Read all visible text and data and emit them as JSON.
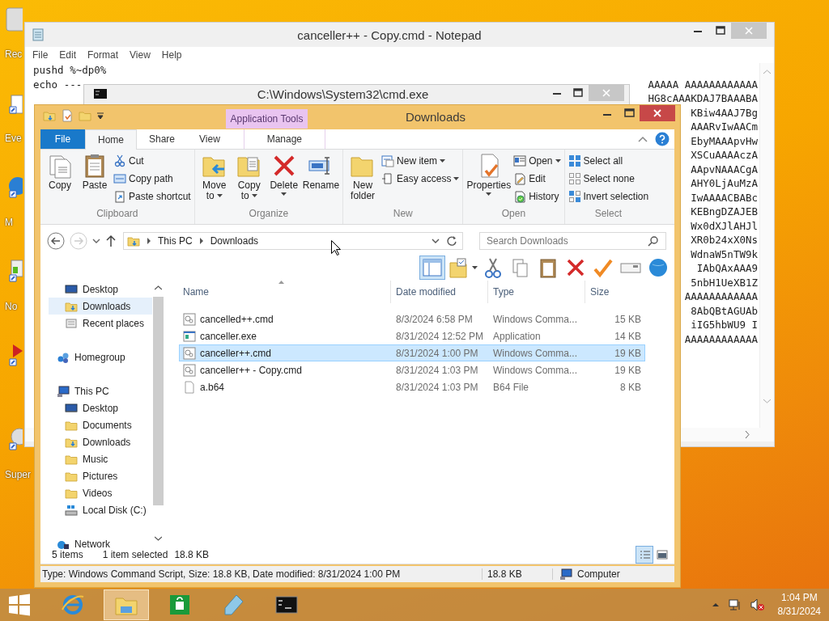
{
  "desktop": {
    "icons": [
      {
        "kind": "bin",
        "label": "Rec"
      },
      {
        "kind": "shortcut",
        "label": "Eve"
      },
      {
        "kind": "browser",
        "label": "M"
      },
      {
        "kind": "notes",
        "label": "No"
      },
      {
        "kind": "media"
      },
      {
        "kind": "disc",
        "label": "Super"
      }
    ]
  },
  "notepad": {
    "title": "canceller++ - Copy.cmd - Notepad",
    "menu": [
      "File",
      "Edit",
      "Format",
      "View",
      "Help"
    ],
    "lines": [
      {
        "left": "pushd %~dp0%"
      },
      {
        "left": "echo ---",
        "right": "AAAAA AAAAAAAAAAAA"
      },
      {
        "right": "HG8cAAAKDAJ7BAAABA"
      },
      {
        "right": "KBiw4AAJ7Bg"
      },
      {
        "right": "AAARvIwAACm"
      },
      {
        "right": "EbyMAAApvHw"
      },
      {
        "right": "XSCuAAAAczA"
      },
      {
        "right": "AApvNAAACgA"
      },
      {
        "right": "AHY0LjAuMzA"
      },
      {
        "right": "IwAAAACBABc"
      },
      {
        "right": "KEBngDZAJEB"
      },
      {
        "right": "Wx0dXJlAHJl"
      },
      {
        "right": "XR0b24xX0Ns"
      },
      {
        "right": "WdnaW5nTW9k"
      },
      {
        "right": "IAbQAxAAA9"
      },
      {
        "right": "5nbH1UeXB1Z"
      },
      {
        "right": "AAAAAAAAAAAA"
      },
      {
        "right": "8AbQBtAGUAb"
      },
      {
        "right": "iIG5hbWU9 I"
      },
      {
        "right": "AAAAAAAAAAAA"
      }
    ]
  },
  "cmd": {
    "title": "C:\\Windows\\System32\\cmd.exe"
  },
  "explorer": {
    "title": "Downloads",
    "context_header": "Application Tools",
    "tabs": [
      {
        "label": "File",
        "kind": "file",
        "selected": false
      },
      {
        "label": "Home",
        "kind": "normal",
        "selected": true
      },
      {
        "label": "Share",
        "kind": "normal",
        "selected": false
      },
      {
        "label": "View",
        "kind": "normal",
        "selected": false
      },
      {
        "label": "Manage",
        "kind": "context",
        "selected": false
      }
    ],
    "ribbon": [
      {
        "label": "Clipboard",
        "items": [
          {
            "label": "Copy",
            "kind": "large",
            "dropdown": false
          },
          {
            "label": "Paste",
            "kind": "large",
            "dropdown": false
          },
          {
            "label": "Cut",
            "kind": "small",
            "dropdown": false
          },
          {
            "label": "Copy path",
            "kind": "small",
            "dropdown": false
          },
          {
            "label": "Paste shortcut",
            "kind": "small",
            "dropdown": false
          }
        ]
      },
      {
        "label": "Organize",
        "items": [
          {
            "label": "Move to",
            "kind": "large",
            "dropdown": true
          },
          {
            "label": "Copy to",
            "kind": "large",
            "dropdown": true
          },
          {
            "label": "Delete",
            "kind": "large",
            "dropdown": true
          },
          {
            "label": "Rename",
            "kind": "large",
            "dropdown": false
          }
        ]
      },
      {
        "label": "New",
        "items": [
          {
            "label": "New folder",
            "kind": "large",
            "dropdown": false
          },
          {
            "label": "New item",
            "kind": "small",
            "dropdown": true
          },
          {
            "label": "Easy access",
            "kind": "small",
            "dropdown": true
          }
        ]
      },
      {
        "label": "Open",
        "items": [
          {
            "label": "Properties",
            "kind": "large",
            "dropdown": true
          },
          {
            "label": "Open",
            "kind": "small",
            "dropdown": true
          },
          {
            "label": "Edit",
            "kind": "small",
            "dropdown": false
          },
          {
            "label": "History",
            "kind": "small",
            "dropdown": false
          }
        ]
      },
      {
        "label": "Select",
        "items": [
          {
            "label": "Select all",
            "kind": "small",
            "dropdown": false
          },
          {
            "label": "Select none",
            "kind": "small",
            "dropdown": false
          },
          {
            "label": "Invert selection",
            "kind": "small",
            "dropdown": false
          }
        ]
      }
    ],
    "address": {
      "crumbs": [
        "This PC",
        "Downloads"
      ]
    },
    "search": {
      "placeholder": "Search Downloads"
    },
    "toolbar": [
      {
        "kind": "pane",
        "selected": true
      },
      {
        "kind": "folder",
        "selected": false
      },
      {
        "kind": "cut",
        "selected": false
      },
      {
        "kind": "copy",
        "selected": false
      },
      {
        "kind": "paste",
        "selected": false
      },
      {
        "kind": "delete",
        "selected": false
      },
      {
        "kind": "check",
        "selected": false
      },
      {
        "kind": "rename",
        "selected": false
      },
      {
        "kind": "globe",
        "selected": false
      }
    ],
    "nav": [
      {
        "children": [
          {
            "label": "Desktop",
            "kind": "desktop",
            "selected": false
          },
          {
            "label": "Downloads",
            "kind": "downloads",
            "selected": true
          },
          {
            "label": "Recent places",
            "kind": "recent",
            "selected": false
          }
        ]
      },
      {
        "label": "Homegroup",
        "kind": "homegroup",
        "selected": false
      },
      {
        "label": "This PC",
        "kind": "pc",
        "selected": false,
        "children": [
          {
            "label": "Desktop",
            "kind": "desktop",
            "selected": false
          },
          {
            "label": "Documents",
            "kind": "folder",
            "selected": false
          },
          {
            "label": "Downloads",
            "kind": "downloads",
            "selected": false
          },
          {
            "label": "Music",
            "kind": "folder",
            "selected": false
          },
          {
            "label": "Pictures",
            "kind": "folder",
            "selected": false
          },
          {
            "label": "Videos",
            "kind": "folder",
            "selected": false
          },
          {
            "label": "Local Disk (C:)",
            "kind": "disk",
            "selected": false
          }
        ]
      },
      {
        "label": "Network",
        "kind": "network",
        "selected": false
      }
    ],
    "columns": [
      "Name",
      "Date modified",
      "Type",
      "Size"
    ],
    "rows": [
      {
        "name": "cancelled++.cmd",
        "date": "8/3/2024 6:58 PM",
        "type": "Windows Comma...",
        "size": "15 KB",
        "kind": "script",
        "selected": false
      },
      {
        "name": "canceller.exe",
        "date": "8/31/2024 12:52 PM",
        "type": "Application",
        "size": "14 KB",
        "kind": "app",
        "selected": false
      },
      {
        "name": "canceller++.cmd",
        "date": "8/31/2024 1:00 PM",
        "type": "Windows Comma...",
        "size": "19 KB",
        "kind": "script",
        "selected": true
      },
      {
        "name": "canceller++ - Copy.cmd",
        "date": "8/31/2024 1:03 PM",
        "type": "Windows Comma...",
        "size": "19 KB",
        "kind": "script",
        "selected": false
      },
      {
        "name": "a.b64",
        "date": "8/31/2024 1:03 PM",
        "type": "B64 File",
        "size": "8 KB",
        "kind": "file",
        "selected": false
      }
    ],
    "status": {
      "count": "5 items",
      "selection": "1 item selected",
      "selection_size": "18.8 KB",
      "views": [
        {
          "kind": "details",
          "selected": true
        },
        {
          "kind": "tiles",
          "selected": false
        }
      ]
    },
    "status_bar": {
      "details": "Type: Windows Command Script, Size: 18.8 KB, Date modified: 8/31/2024 1:00 PM",
      "size": "18.8 KB",
      "zone": "Computer"
    }
  },
  "taskbar": {
    "apps": [
      {
        "kind": "ie",
        "selected": false
      },
      {
        "kind": "explorer",
        "selected": true
      },
      {
        "kind": "store",
        "selected": false
      },
      {
        "kind": "notepad",
        "selected": false
      },
      {
        "kind": "cmd",
        "selected": false
      }
    ],
    "time": "1:04 PM",
    "date": "8/31/2024"
  }
}
